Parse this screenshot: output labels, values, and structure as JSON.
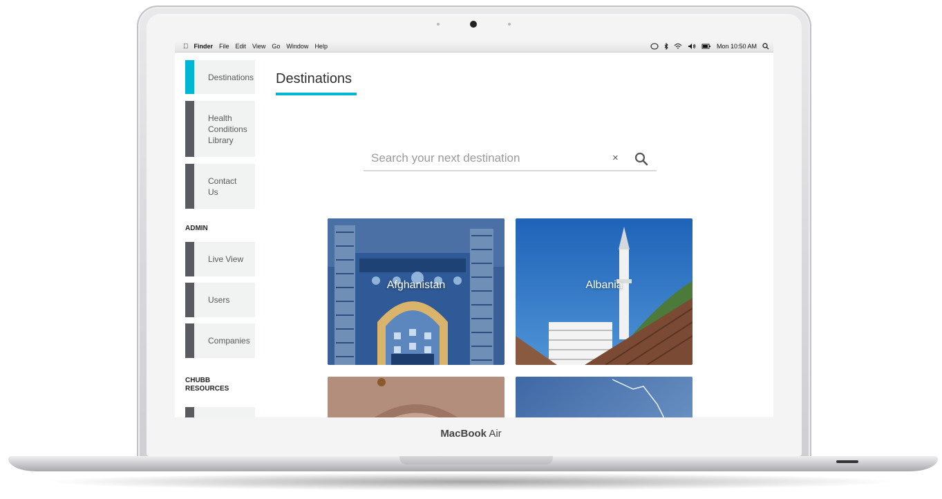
{
  "device": {
    "brand_bold": "MacBook",
    "brand_light": " Air"
  },
  "menubar": {
    "apple_icon": "apple-icon",
    "app": "Finder",
    "items": [
      "File",
      "Edit",
      "View",
      "Go",
      "Window",
      "Help"
    ],
    "clock": "Mon 10:50 AM",
    "status_icons": [
      "notification-icon",
      "bluetooth-icon",
      "wifi-icon",
      "volume-icon",
      "battery-icon",
      "spotlight-icon"
    ]
  },
  "sidebar": {
    "items": [
      {
        "label": "Destinations",
        "active": true
      },
      {
        "label": "Health Conditions Library"
      },
      {
        "label": "Contact Us"
      }
    ],
    "admin_heading": "ADMIN",
    "admin_items": [
      {
        "label": "Live View"
      },
      {
        "label": "Users"
      },
      {
        "label": "Companies"
      }
    ],
    "resources_heading": "CHUBB RESOURCES"
  },
  "main": {
    "title": "Destinations",
    "search": {
      "placeholder": "Search your next destination",
      "value": "",
      "clear": "×"
    },
    "cards": [
      {
        "name": "Afghanistan"
      },
      {
        "name": "Albania"
      },
      {
        "name": ""
      },
      {
        "name": ""
      }
    ]
  },
  "colors": {
    "accent": "#00b6d3",
    "nav_bar": "#5a5b60",
    "nav_bg": "#f1f2f2"
  }
}
